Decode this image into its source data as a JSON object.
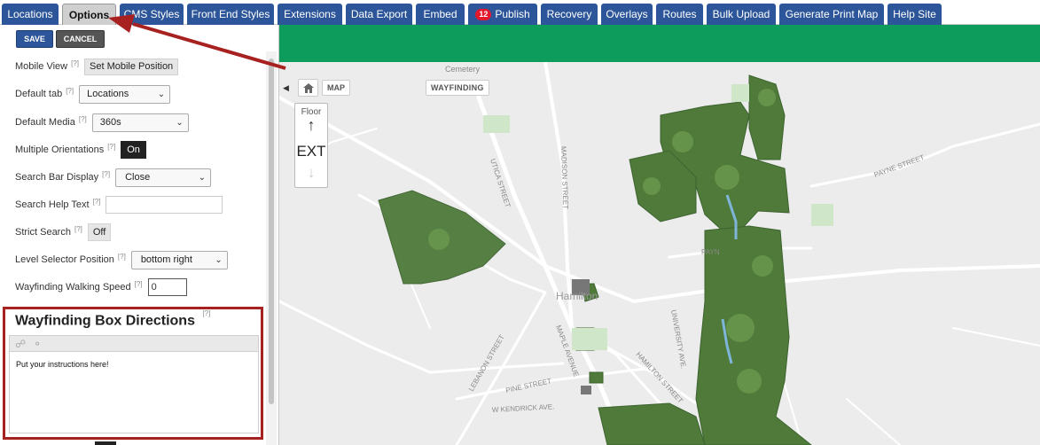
{
  "tabs": [
    {
      "label": "Locations"
    },
    {
      "label": "Options"
    },
    {
      "label": "CMS Styles"
    },
    {
      "label": "Front End Styles"
    },
    {
      "label": "Extensions"
    },
    {
      "label": "Data Export"
    },
    {
      "label": "Embed"
    },
    {
      "label": "Publish",
      "badge": "12"
    },
    {
      "label": "Recovery"
    },
    {
      "label": "Overlays"
    },
    {
      "label": "Routes"
    },
    {
      "label": "Bulk Upload"
    },
    {
      "label": "Generate Print Map"
    },
    {
      "label": "Help Site"
    }
  ],
  "active_tab": "Options",
  "actions": {
    "save": "SAVE",
    "cancel": "CANCEL"
  },
  "help_marker": "[?]",
  "settings": {
    "mobile_view": {
      "label": "Mobile View",
      "button": "Set Mobile Position"
    },
    "default_tab": {
      "label": "Default tab",
      "value": "Locations"
    },
    "default_media": {
      "label": "Default Media",
      "value": "360s"
    },
    "multiple_orientations": {
      "label": "Multiple Orientations",
      "value": "On"
    },
    "search_bar_display": {
      "label": "Search Bar Display",
      "value": "Close"
    },
    "search_help_text": {
      "label": "Search Help Text",
      "value": ""
    },
    "strict_search": {
      "label": "Strict Search",
      "value": "Off"
    },
    "level_selector_position": {
      "label": "Level Selector Position",
      "value": "bottom right"
    },
    "wayfinding_walking_speed": {
      "label": "Wayfinding Walking Speed",
      "value": "0"
    }
  },
  "wayfinding_box": {
    "title": "Wayfinding Box Directions",
    "content": "Put your instructions here!"
  },
  "map": {
    "map_button": "MAP",
    "wayfinding_button": "WAYFINDING",
    "floor_label": "Floor",
    "floor_value": "EXT",
    "labels": {
      "cemetery": "Cemetery",
      "utica": "UTICA STREET",
      "madison": "MADISON STREET",
      "payne": "PAYNE STREET",
      "payne2": "PAYN",
      "hamilton": "Hamilton",
      "maple": "MAPLE AVENUE",
      "lebanon": "LEBANON STREET",
      "university": "UNIVERSITY AVE.",
      "hamilton_st": "HAMILTON STREET",
      "pine": "PINE STREET",
      "kendrick": "W KENDRICK AVE."
    }
  },
  "colors": {
    "tab_blue": "#2c5699",
    "green_bar": "#0e9c5d",
    "annotation_red": "#a82121",
    "badge_red": "#e3182d"
  }
}
